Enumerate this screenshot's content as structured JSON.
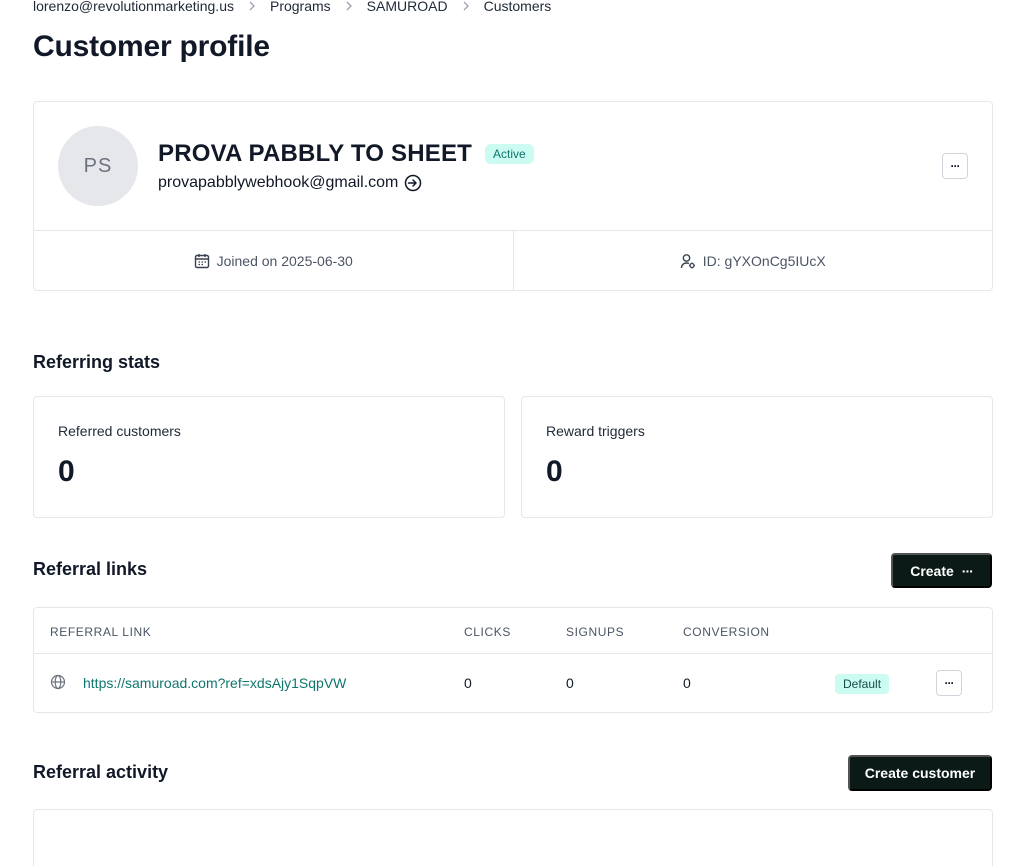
{
  "breadcrumb": {
    "items": [
      "lorenzo@revolutionmarketing.us",
      "Programs",
      "SAMUROAD",
      "Customers"
    ]
  },
  "page": {
    "title": "Customer profile"
  },
  "profile": {
    "initials": "PS",
    "name": "PROVA PABBLY TO SHEET",
    "status": "Active",
    "email": "provapabblywebhook@gmail.com",
    "joined": "Joined on 2025-06-30",
    "id": "ID: gYXOnCg5IUcX",
    "more_label": "···"
  },
  "referring_stats": {
    "title": "Referring stats",
    "referred_customers_label": "Referred customers",
    "referred_customers_value": "0",
    "reward_triggers_label": "Reward triggers",
    "reward_triggers_value": "0"
  },
  "referral_links": {
    "title": "Referral links",
    "create_label": "Create",
    "create_dots": "···",
    "columns": [
      "REFERRAL LINK",
      "CLICKS",
      "SIGNUPS",
      "CONVERSION"
    ],
    "rows": [
      {
        "link": "https://samuroad.com?ref=xdsAjy1SqpVW",
        "clicks": "0",
        "signups": "0",
        "conversion": "0",
        "badge": "Default",
        "more_label": "···"
      }
    ]
  },
  "referral_activity": {
    "title": "Referral activity",
    "create_customer_label": "Create customer"
  },
  "colors": {
    "accent_teal": "#0f766e",
    "badge_bg": "#ccfbf1",
    "dark_button": "#0b1a17",
    "border": "#e5e7eb"
  },
  "icons": {
    "breadcrumb_separator": "chevron-right-icon",
    "email_action": "sign-in-icon",
    "joined": "calendar-icon",
    "id": "user-gear-icon",
    "link": "globe-icon"
  }
}
